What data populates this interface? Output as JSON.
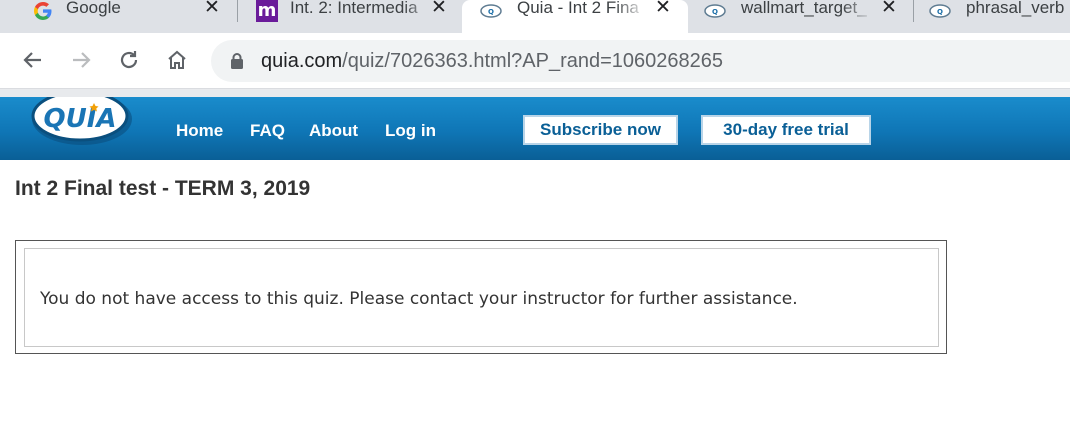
{
  "browser": {
    "tabs": [
      {
        "title": "Google",
        "favicon": "google-g-icon",
        "active": false
      },
      {
        "title": "Int. 2: Intermedia",
        "favicon": "m-logo-icon",
        "active": false
      },
      {
        "title": "Quia - Int 2 Fina",
        "favicon": "quia-icon",
        "active": true
      },
      {
        "title": "wallmart_target_",
        "favicon": "quia-icon",
        "active": false
      },
      {
        "title": "phrasal_verb",
        "favicon": "quia-icon",
        "active": false
      }
    ],
    "close_glyph": "✕",
    "url_domain": "quia.com",
    "url_path": "/quiz/7026363.html?AP_rand=1060268265",
    "colors": {
      "tabstrip": "#dee1e6",
      "omnibox": "#f1f3f4"
    }
  },
  "quia": {
    "logo_text": "QUIA",
    "nav": {
      "home": "Home",
      "faq": "FAQ",
      "about": "About",
      "login": "Log in"
    },
    "subscribe_label": "Subscribe now",
    "trial_label": "30-day free trial",
    "colors": {
      "header_blue": "#0f76b6",
      "cta_text": "#0a5f96"
    }
  },
  "page": {
    "title": "Int 2 Final test - TERM 3, 2019",
    "message": "You do not have access to this quiz. Please contact your instructor for further assistance."
  }
}
